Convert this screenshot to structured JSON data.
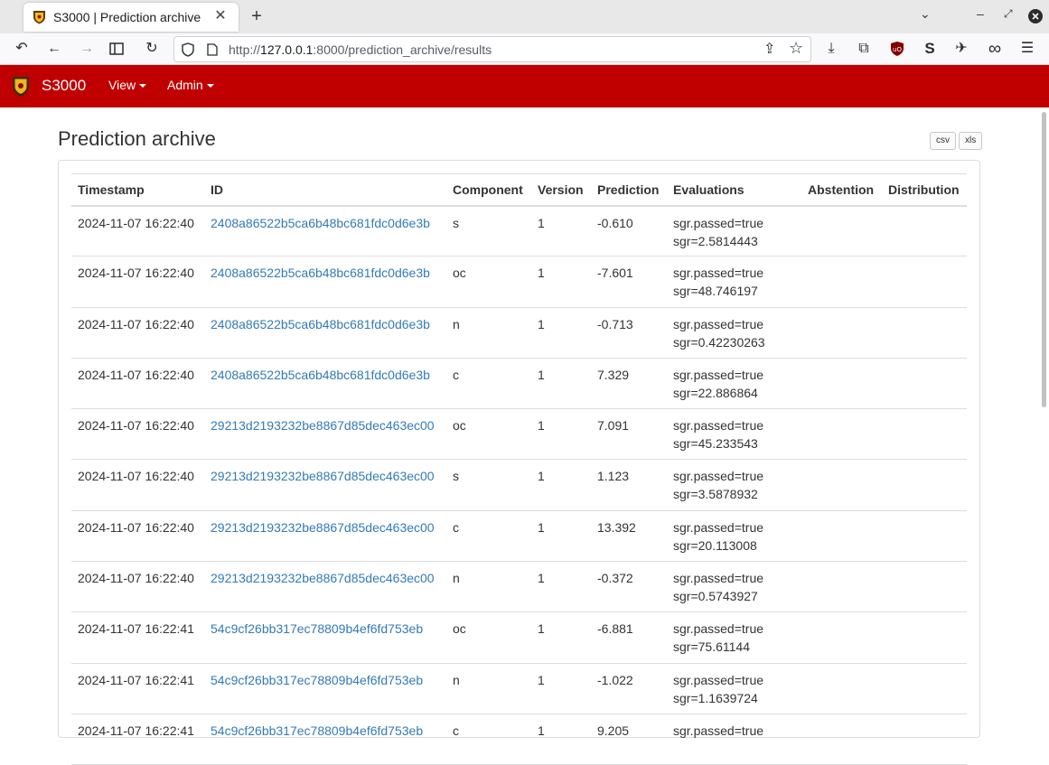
{
  "browser": {
    "tab_title": "S3000 | Prediction archive",
    "new_tab": "+",
    "url_prefix": "http://",
    "url_host": "127.0.0.1",
    "url_rest": ":8000/prediction_archive/results"
  },
  "app": {
    "brand": "S3000",
    "menu": [
      {
        "label": "View"
      },
      {
        "label": "Admin"
      }
    ]
  },
  "page": {
    "title": "Prediction archive",
    "export_csv": "csv",
    "export_xls": "xls"
  },
  "table": {
    "headers": [
      "Timestamp",
      "ID",
      "Component",
      "Version",
      "Prediction",
      "Evaluations",
      "Abstention",
      "Distribution"
    ],
    "rows": [
      {
        "timestamp": "2024-11-07 16:22:40",
        "id": "2408a86522b5ca6b48bc681fdc0d6e3b",
        "component": "s",
        "version": "1",
        "prediction": "-0.610",
        "eval1": "sgr.passed=true",
        "eval2": "sgr=2.5814443",
        "abstention": "",
        "distribution": ""
      },
      {
        "timestamp": "2024-11-07 16:22:40",
        "id": "2408a86522b5ca6b48bc681fdc0d6e3b",
        "component": "oc",
        "version": "1",
        "prediction": "-7.601",
        "eval1": "sgr.passed=true",
        "eval2": "sgr=48.746197",
        "abstention": "",
        "distribution": ""
      },
      {
        "timestamp": "2024-11-07 16:22:40",
        "id": "2408a86522b5ca6b48bc681fdc0d6e3b",
        "component": "n",
        "version": "1",
        "prediction": "-0.713",
        "eval1": "sgr.passed=true",
        "eval2": "sgr=0.42230263",
        "abstention": "",
        "distribution": ""
      },
      {
        "timestamp": "2024-11-07 16:22:40",
        "id": "2408a86522b5ca6b48bc681fdc0d6e3b",
        "component": "c",
        "version": "1",
        "prediction": "7.329",
        "eval1": "sgr.passed=true",
        "eval2": "sgr=22.886864",
        "abstention": "",
        "distribution": ""
      },
      {
        "timestamp": "2024-11-07 16:22:40",
        "id": "29213d2193232be8867d85dec463ec00",
        "component": "oc",
        "version": "1",
        "prediction": "7.091",
        "eval1": "sgr.passed=true",
        "eval2": "sgr=45.233543",
        "abstention": "",
        "distribution": ""
      },
      {
        "timestamp": "2024-11-07 16:22:40",
        "id": "29213d2193232be8867d85dec463ec00",
        "component": "s",
        "version": "1",
        "prediction": "1.123",
        "eval1": "sgr.passed=true",
        "eval2": "sgr=3.5878932",
        "abstention": "",
        "distribution": ""
      },
      {
        "timestamp": "2024-11-07 16:22:40",
        "id": "29213d2193232be8867d85dec463ec00",
        "component": "c",
        "version": "1",
        "prediction": "13.392",
        "eval1": "sgr.passed=true",
        "eval2": "sgr=20.113008",
        "abstention": "",
        "distribution": ""
      },
      {
        "timestamp": "2024-11-07 16:22:40",
        "id": "29213d2193232be8867d85dec463ec00",
        "component": "n",
        "version": "1",
        "prediction": "-0.372",
        "eval1": "sgr.passed=true",
        "eval2": "sgr=0.5743927",
        "abstention": "",
        "distribution": ""
      },
      {
        "timestamp": "2024-11-07 16:22:41",
        "id": "54c9cf26bb317ec78809b4ef6fd753eb",
        "component": "oc",
        "version": "1",
        "prediction": "-6.881",
        "eval1": "sgr.passed=true",
        "eval2": "sgr=75.61144",
        "abstention": "",
        "distribution": ""
      },
      {
        "timestamp": "2024-11-07 16:22:41",
        "id": "54c9cf26bb317ec78809b4ef6fd753eb",
        "component": "n",
        "version": "1",
        "prediction": "-1.022",
        "eval1": "sgr.passed=true",
        "eval2": "sgr=1.1639724",
        "abstention": "",
        "distribution": ""
      },
      {
        "timestamp": "2024-11-07 16:22:41",
        "id": "54c9cf26bb317ec78809b4ef6fd753eb",
        "component": "c",
        "version": "1",
        "prediction": "9.205",
        "eval1": "sgr.passed=true",
        "eval2": "",
        "abstention": "",
        "distribution": ""
      }
    ]
  },
  "colors": {
    "header_bg": "#c00000",
    "link": "#337ab7",
    "text": "#333333"
  }
}
